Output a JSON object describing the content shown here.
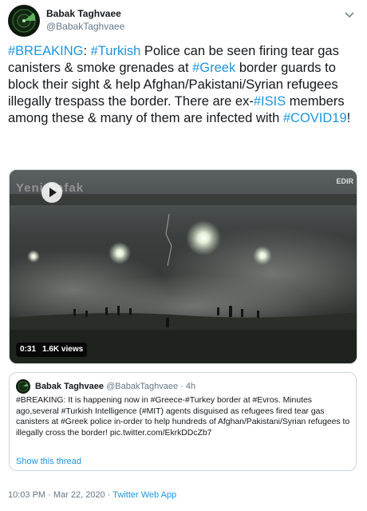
{
  "author": {
    "name": "Babak Taghvaee",
    "handle": "@BabakTaghvaee"
  },
  "tweet": {
    "parts": [
      {
        "t": "#BREAKING",
        "tag": true
      },
      {
        "t": ": ",
        "tag": false
      },
      {
        "t": "#Turkish",
        "tag": true
      },
      {
        "t": " Police can be seen firing tear gas canisters & smoke grenades at ",
        "tag": false
      },
      {
        "t": "#Greek",
        "tag": true
      },
      {
        "t": " border guards to block their sight & help Afghan/Pakistani/Syrian refugees illegally trespass the border. There are ex-",
        "tag": false
      },
      {
        "t": "#ISIS",
        "tag": true
      },
      {
        "t": " members among these & many of them are infected with ",
        "tag": false
      },
      {
        "t": "#COVID19",
        "tag": true
      },
      {
        "t": "!",
        "tag": false
      }
    ]
  },
  "video": {
    "watermark_left": "Yeni Şafak",
    "watermark_right": "EDIR",
    "duration": "0:31",
    "views": "1.6K views"
  },
  "quoted": {
    "name": "Babak Taghvaee",
    "handle": "@BabakTaghvaee",
    "separator": " · ",
    "time": "4h",
    "text": "#BREAKING: It is happening now in #Greece-#Turkey border at #Evros. Minutes ago,several #Turkish Intelligence (#MIT) agents disguised as refugees fired tear gas canisters at #Greek police in-order to help hundreds of Afghan/Pakistani/Syrian refugees to illegally cross the border! pic.twitter.com/EkrkDDcZb7",
    "show_thread": "Show this thread"
  },
  "footer": {
    "timestamp": "10:03 PM · Mar 22, 2020",
    "separator": " · ",
    "source": "Twitter Web App"
  },
  "icons": {
    "avatar": "radar-logo-icon",
    "menu": "chevron-down-icon",
    "play": "play-icon"
  },
  "colors": {
    "link": "#1b95e0",
    "text": "#14171a",
    "secondary": "#657786",
    "border": "#ccd6dd"
  }
}
